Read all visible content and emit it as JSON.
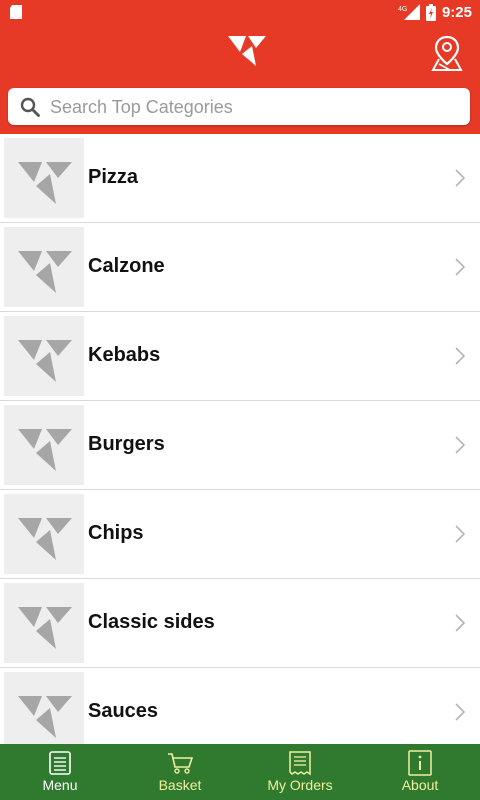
{
  "status_bar": {
    "network": "4G",
    "time": "9:25"
  },
  "header": {
    "logo_icon": "pizza-slices-logo-icon",
    "location_icon": "map-pin-icon"
  },
  "search": {
    "placeholder": "Search Top Categories",
    "value": ""
  },
  "categories": [
    {
      "label": "Pizza"
    },
    {
      "label": "Calzone"
    },
    {
      "label": "Kebabs"
    },
    {
      "label": "Burgers"
    },
    {
      "label": "Chips"
    },
    {
      "label": "Classic sides"
    },
    {
      "label": "Sauces"
    }
  ],
  "bottom_nav": [
    {
      "label": "Menu",
      "icon": "menu-icon",
      "active": true
    },
    {
      "label": "Basket",
      "icon": "basket-icon",
      "active": false
    },
    {
      "label": "My Orders",
      "icon": "orders-icon",
      "active": false
    },
    {
      "label": "About",
      "icon": "info-icon",
      "active": false
    }
  ],
  "colors": {
    "primary": "#e63a26",
    "nav": "#2f7a2f",
    "nav_label_inactive": "#f2ef9e"
  }
}
